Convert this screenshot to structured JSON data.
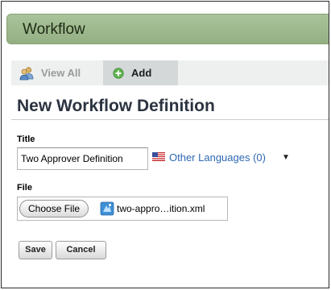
{
  "portlet": {
    "title": "Workflow"
  },
  "tabs": [
    {
      "label": "View All",
      "icon": "users-icon"
    },
    {
      "label": "Add",
      "icon": "add-circle-icon"
    }
  ],
  "page": {
    "title": "New Workflow Definition"
  },
  "form": {
    "title_label": "Title",
    "title_value": "Two Approver Definition",
    "languages_link": "Other Languages (0)",
    "languages_arrow": "▼",
    "file_label": "File",
    "choose_file_label": "Choose File",
    "file_name": "two-appro…ition.xml",
    "save_label": "Save",
    "cancel_label": "Cancel"
  },
  "colors": {
    "header_bg": "#a9c39a",
    "link": "#2e68b3",
    "tab_active_bg": "#d4d8d8"
  }
}
